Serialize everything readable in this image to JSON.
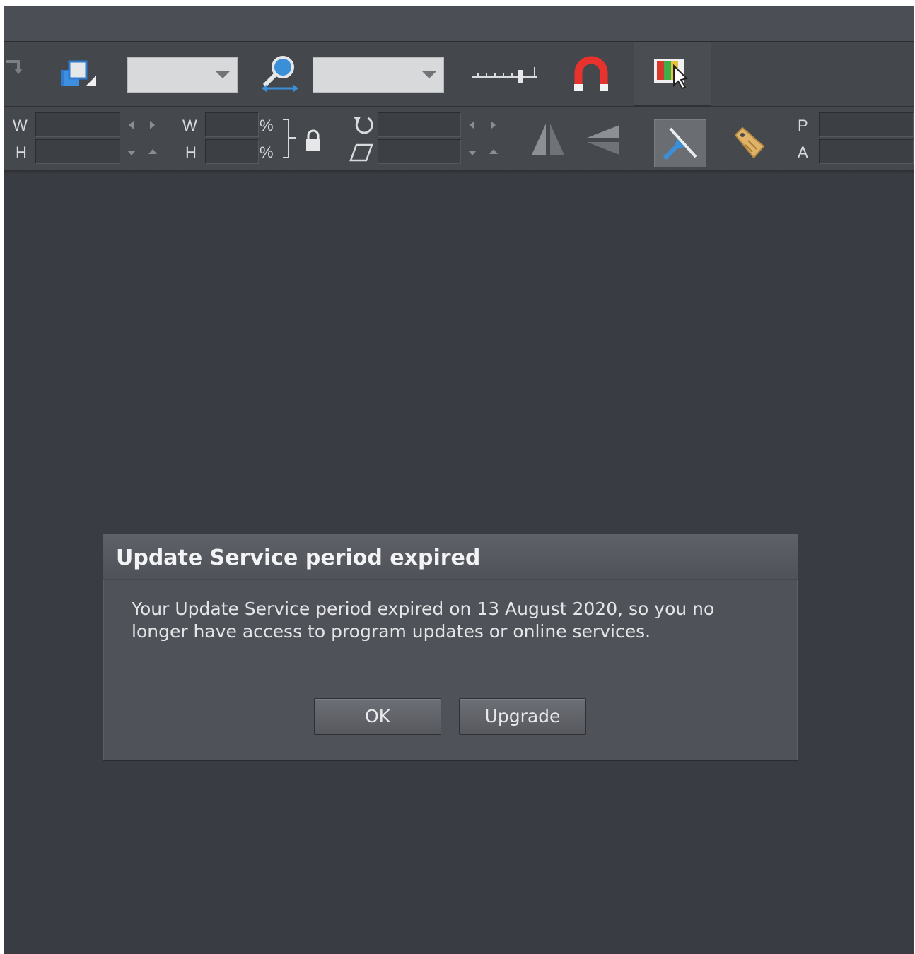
{
  "toolbar": {
    "size_labels": {
      "w": "W",
      "h": "H"
    },
    "scale_labels": {
      "w": "W",
      "h": "H",
      "w_unit": "%",
      "h_unit": "%"
    },
    "position_labels": {
      "p": "P",
      "a": "A"
    },
    "icons": [
      "back-icon",
      "arrange-icon",
      "zoom-icon",
      "ruler-icon",
      "snap-magnet-icon",
      "color-picker-icon",
      "lock-icon",
      "rotate-icon",
      "skew-icon",
      "flip-horizontal-icon",
      "flip-vertical-icon",
      "selector-tool-icon",
      "tag-icon"
    ],
    "accent_colors": {
      "magnet": "#e8322d",
      "tag": "#e0b468",
      "selector_arrow": "#3b8fd9"
    }
  },
  "dialog": {
    "title": "Update Service period expired",
    "message": "Your Update Service period expired on 13 August 2020, so you no longer have access to program updates or online services.",
    "ok_label": "OK",
    "upgrade_label": "Upgrade"
  }
}
